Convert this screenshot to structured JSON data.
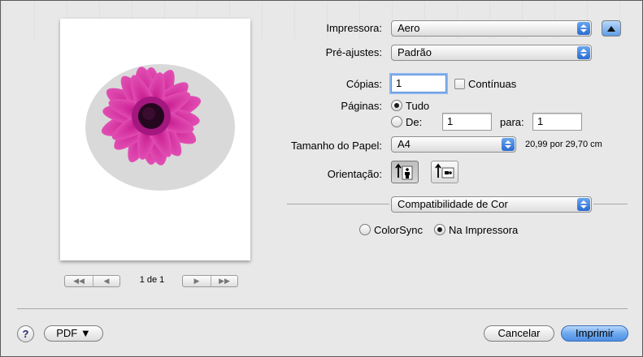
{
  "printer": {
    "label": "Impressora:",
    "value": "Aero"
  },
  "presets": {
    "label": "Pré-ajustes:",
    "value": "Padrão"
  },
  "copies": {
    "label": "Cópias:",
    "value": "1",
    "collated_label": "Contínuas",
    "collated": false
  },
  "pages": {
    "label": "Páginas:",
    "all_label": "Tudo",
    "range_label": "De:",
    "from": "1",
    "to_label": "para:",
    "to": "1",
    "selected": "all"
  },
  "paper_size": {
    "label": "Tamanho do Papel:",
    "value": "A4",
    "dimensions": "20,99 por 29,70 cm"
  },
  "orientation": {
    "label": "Orientação:",
    "options": [
      "portrait-icon",
      "landscape-icon"
    ],
    "selected": "portrait"
  },
  "section_popup": {
    "value": "Compatibilidade de Cor"
  },
  "color_options": {
    "colorsync_label": "ColorSync",
    "printer_label": "Na Impressora",
    "selected": "printer"
  },
  "preview_nav": {
    "page_indicator": "1 de 1"
  },
  "footer": {
    "help_label": "?",
    "pdf_label": "PDF ▼",
    "cancel_label": "Cancelar",
    "print_label": "Imprimir"
  },
  "colors": {
    "default_button": "#5a97e8",
    "flower": "#c01a8c",
    "flower_center": "#24071e"
  }
}
